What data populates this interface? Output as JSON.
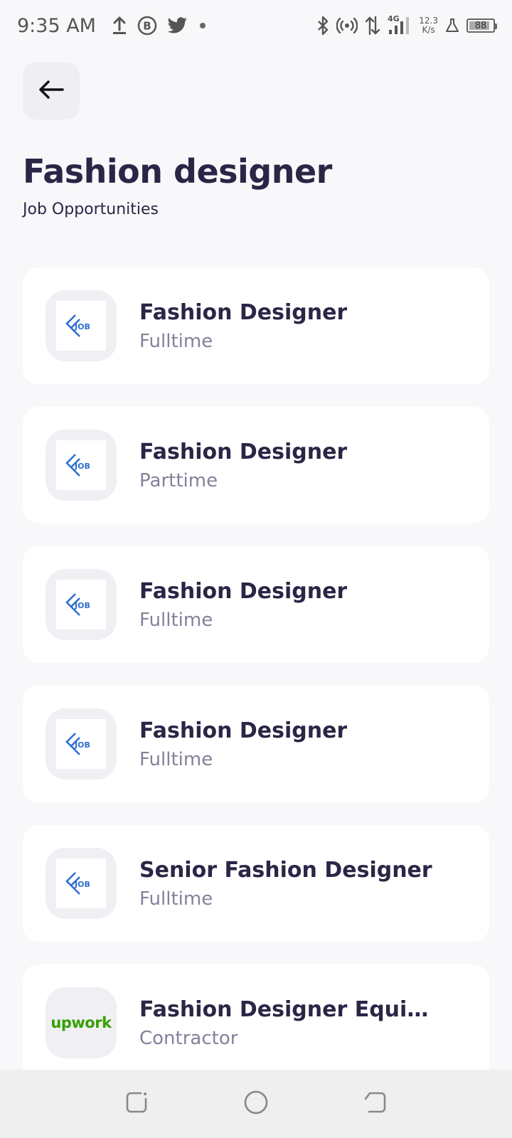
{
  "status_bar": {
    "time": "9:35 AM",
    "net_speed_value": "12.3",
    "net_speed_unit": "K/s",
    "network_type": "4G",
    "battery_level": "88",
    "left_icons": [
      "upload-icon",
      "b-circle-icon",
      "twitter-icon",
      "dot-icon"
    ],
    "right_icons": [
      "bluetooth-icon",
      "hotspot-icon",
      "data-arrows-icon",
      "signal-icon",
      "net-speed",
      "flask-icon",
      "battery-icon"
    ]
  },
  "header": {
    "back_icon": "arrow-left-icon",
    "title": "Fashion designer",
    "subtitle": "Job Opportunities"
  },
  "jobs": [
    {
      "title": "Fashion Designer",
      "type": "Fulltime",
      "logo": "job-logo"
    },
    {
      "title": "Fashion Designer",
      "type": "Parttime",
      "logo": "job-logo"
    },
    {
      "title": "Fashion Designer",
      "type": "Fulltime",
      "logo": "job-logo"
    },
    {
      "title": "Fashion Designer",
      "type": "Fulltime",
      "logo": "job-logo"
    },
    {
      "title": "Senior Fashion Designer",
      "type": "Fulltime",
      "logo": "job-logo"
    },
    {
      "title": "Fashion Designer Equity o...",
      "type": "Contractor",
      "logo": "upwork-logo",
      "logo_text": "upwork"
    }
  ],
  "nav_bar": {
    "icons": [
      "recent-apps-icon",
      "home-icon",
      "back-icon"
    ]
  },
  "colors": {
    "background": "#f8f8fb",
    "card": "#ffffff",
    "title": "#2b2546",
    "subtle_text": "#84819a",
    "logo_blue": "#2f6fd0",
    "upwork_green": "#37a000"
  }
}
